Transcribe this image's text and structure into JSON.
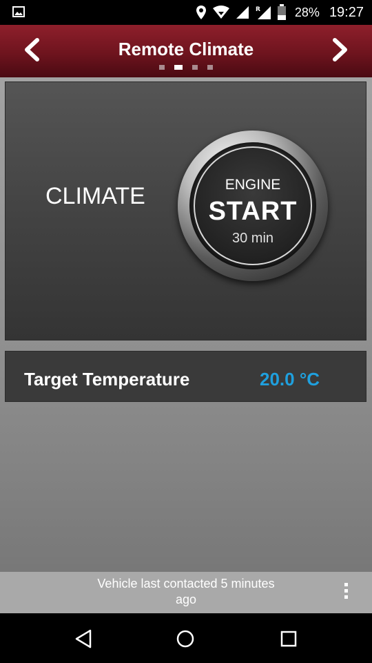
{
  "status_bar": {
    "battery_percent": "28%",
    "time": "19:27",
    "icons": [
      "image-icon",
      "location-icon",
      "wifi-icon",
      "signal-icon",
      "roaming-signal-icon",
      "battery-icon"
    ]
  },
  "header": {
    "title": "Remote Climate",
    "page_count": 4,
    "active_page": 2,
    "background_color": "#6e141e"
  },
  "climate_panel": {
    "label": "CLIMATE",
    "engine_button": {
      "top_text": "ENGINE",
      "main_text": "START",
      "duration": "30 min"
    }
  },
  "target_temperature": {
    "label": "Target Temperature",
    "value": "20.0 °C",
    "value_color": "#1fa0de"
  },
  "contact_status": {
    "text": "Vehicle last contacted 5 minutes ago"
  },
  "nav_bar": {
    "buttons": [
      "back-icon",
      "home-icon",
      "recents-icon"
    ]
  }
}
